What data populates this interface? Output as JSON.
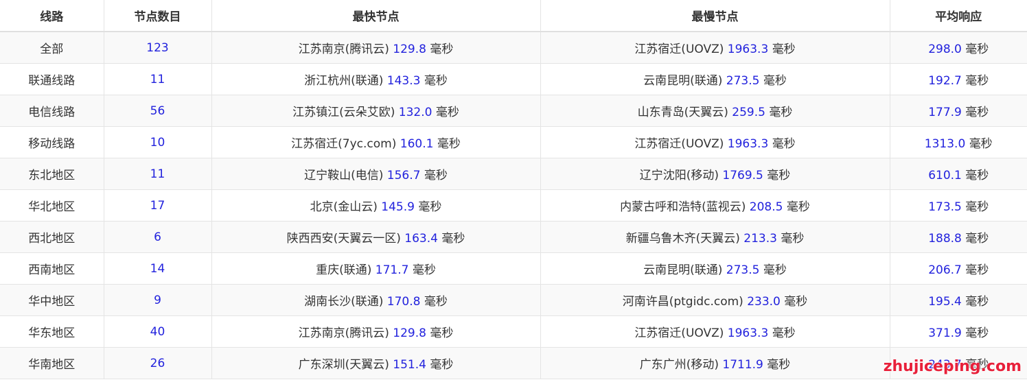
{
  "colors": {
    "number": "#2222dd",
    "text": "#333333",
    "watermark": "#e8203a"
  },
  "headers": [
    "线路",
    "节点数目",
    "最快节点",
    "最慢节点",
    "平均响应"
  ],
  "rows": [
    {
      "route": "全部",
      "count": "123",
      "fast_name": "江苏南京(腾讯云)",
      "fast_ms": "129.8",
      "slow_name": "江苏宿迁(UOVZ)",
      "slow_ms": "1963.3",
      "avg_ms": "298.0"
    },
    {
      "route": "联通线路",
      "count": "11",
      "fast_name": "浙江杭州(联通)",
      "fast_ms": "143.3",
      "slow_name": "云南昆明(联通)",
      "slow_ms": "273.5",
      "avg_ms": "192.7"
    },
    {
      "route": "电信线路",
      "count": "56",
      "fast_name": "江苏镇江(云朵艾欧)",
      "fast_ms": "132.0",
      "slow_name": "山东青岛(天翼云)",
      "slow_ms": "259.5",
      "avg_ms": "177.9"
    },
    {
      "route": "移动线路",
      "count": "10",
      "fast_name": "江苏宿迁(7yc.com)",
      "fast_ms": "160.1",
      "slow_name": "江苏宿迁(UOVZ)",
      "slow_ms": "1963.3",
      "avg_ms": "1313.0"
    },
    {
      "route": "东北地区",
      "count": "11",
      "fast_name": "辽宁鞍山(电信)",
      "fast_ms": "156.7",
      "slow_name": "辽宁沈阳(移动)",
      "slow_ms": "1769.5",
      "avg_ms": "610.1"
    },
    {
      "route": "华北地区",
      "count": "17",
      "fast_name": "北京(金山云)",
      "fast_ms": "145.9",
      "slow_name": "内蒙古呼和浩特(蓝视云)",
      "slow_ms": "208.5",
      "avg_ms": "173.5"
    },
    {
      "route": "西北地区",
      "count": "6",
      "fast_name": "陕西西安(天翼云一区)",
      "fast_ms": "163.4",
      "slow_name": "新疆乌鲁木齐(天翼云)",
      "slow_ms": "213.3",
      "avg_ms": "188.8"
    },
    {
      "route": "西南地区",
      "count": "14",
      "fast_name": "重庆(联通)",
      "fast_ms": "171.7",
      "slow_name": "云南昆明(联通)",
      "slow_ms": "273.5",
      "avg_ms": "206.7"
    },
    {
      "route": "华中地区",
      "count": "9",
      "fast_name": "湖南长沙(联通)",
      "fast_ms": "170.8",
      "slow_name": "河南许昌(ptgidc.com)",
      "slow_ms": "233.0",
      "avg_ms": "195.4"
    },
    {
      "route": "华东地区",
      "count": "40",
      "fast_name": "江苏南京(腾讯云)",
      "fast_ms": "129.8",
      "slow_name": "江苏宿迁(UOVZ)",
      "slow_ms": "1963.3",
      "avg_ms": "371.9"
    },
    {
      "route": "华南地区",
      "count": "26",
      "fast_name": "广东深圳(天翼云)",
      "fast_ms": "151.4",
      "slow_name": "广东广州(移动)",
      "slow_ms": "1711.9",
      "avg_ms": "243.7"
    }
  ],
  "unit": "毫秒",
  "watermark": "zhujiceping.com"
}
